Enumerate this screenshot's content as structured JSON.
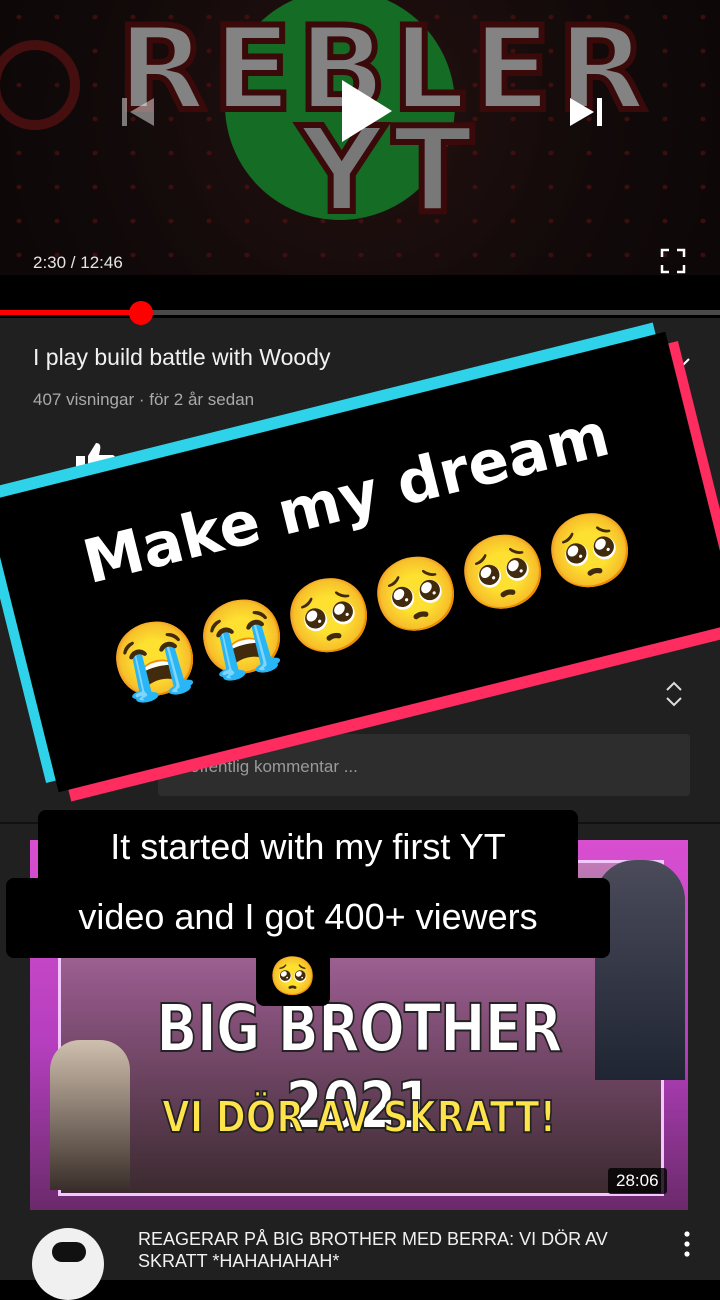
{
  "player": {
    "channel_logo_line1": "REBLER",
    "channel_logo_line2": "YT",
    "time_display": "2:30 / 12:46",
    "progress_fraction": 0.196,
    "icons": {
      "previous": "skip-previous-icon",
      "play": "play-icon",
      "next": "skip-next-icon",
      "fullscreen": "fullscreen-icon"
    }
  },
  "video": {
    "title": "I play build battle with Woody",
    "meta": "407 visningar · för 2 år sedan",
    "like_icon": "thumbs-up-icon"
  },
  "comments": {
    "placeholder": "offentlig kommentar ..."
  },
  "overlay": {
    "line1": "Make my dream",
    "line2": "😭😭🥺🥺🥺🥺"
  },
  "caption": {
    "line1": "It started with my first YT",
    "line2": "video and I got 400+ viewers",
    "emoji": "🥺"
  },
  "next_video": {
    "thumb_headline": "BIG BROTHER 2021",
    "thumb_subline": "VI DÖR AV SKRATT!",
    "duration": "28:06",
    "title": "REAGERAR PÅ BIG BROTHER MED BERRA: VI DÖR AV SKRATT *HAHAHAHAH*"
  },
  "colors": {
    "progress": "#ff0000",
    "panel": "#202020",
    "banner_cyan": "#2ed3ea",
    "banner_pink": "#ff2d5f"
  }
}
